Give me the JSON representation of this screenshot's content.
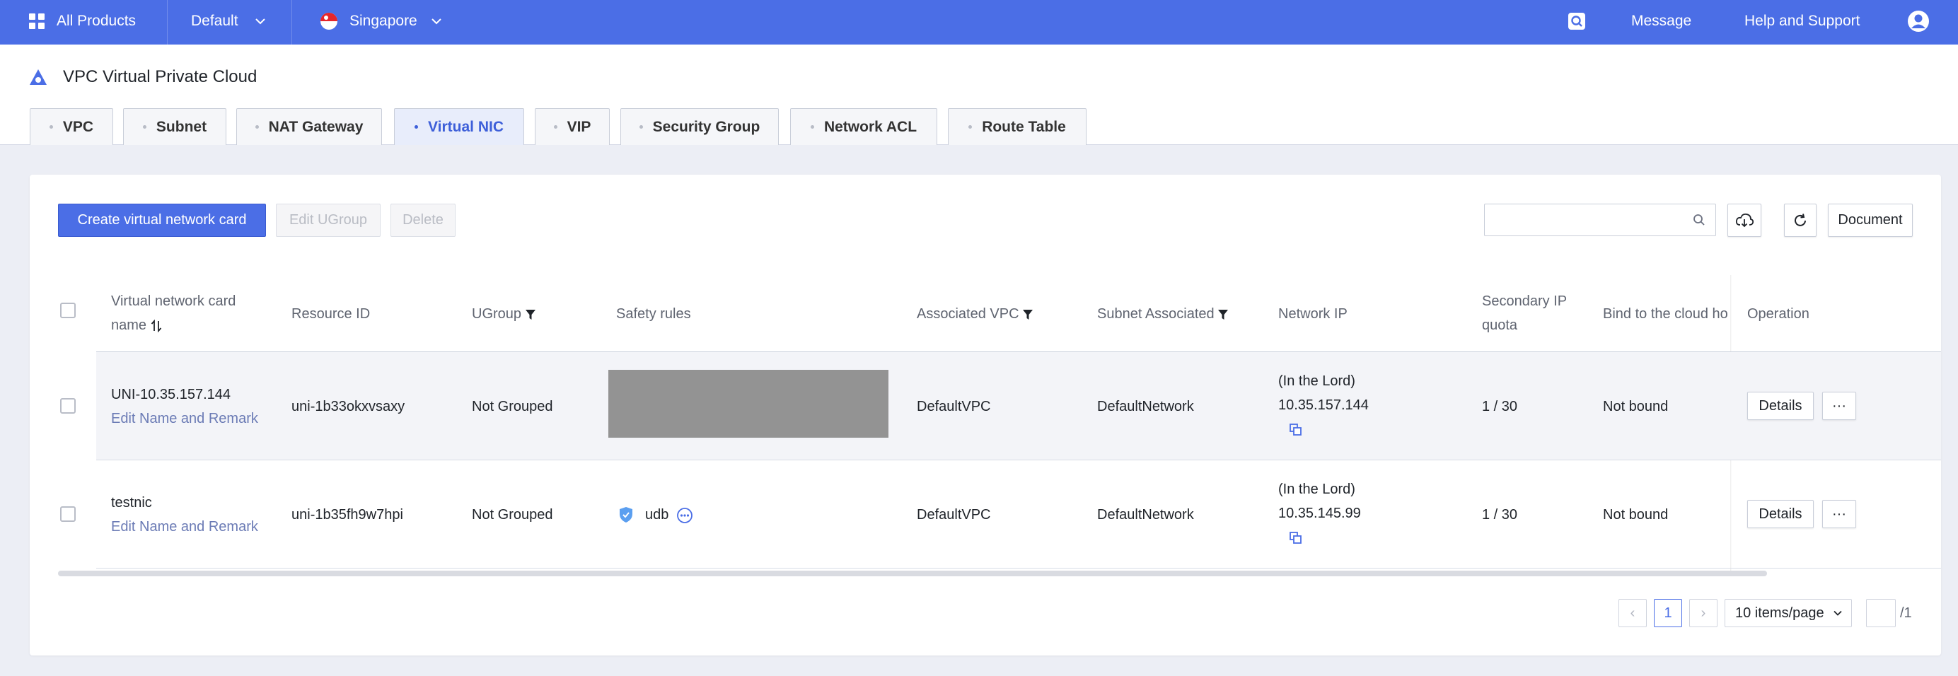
{
  "topbar": {
    "all_products": "All Products",
    "project": "Default",
    "region": "Singapore",
    "message": "Message",
    "help": "Help and Support",
    "icons": [
      "grid-icon",
      "chevron-down-icon",
      "singapore-flag-icon",
      "search-icon",
      "user-icon"
    ]
  },
  "page": {
    "title": "VPC Virtual Private Cloud"
  },
  "tabs": [
    {
      "label": "VPC"
    },
    {
      "label": "Subnet"
    },
    {
      "label": "NAT Gateway"
    },
    {
      "label": "Virtual NIC"
    },
    {
      "label": "VIP"
    },
    {
      "label": "Security Group"
    },
    {
      "label": "Network ACL"
    },
    {
      "label": "Route Table"
    }
  ],
  "active_tab": "Virtual NIC",
  "toolbar": {
    "create_label": "Create virtual network card",
    "edit_ugroup_label": "Edit UGroup",
    "delete_label": "Delete",
    "search_placeholder": "",
    "document_label": "Document"
  },
  "table": {
    "headers": {
      "name_line1": "Virtual network card",
      "name_line2": "name",
      "resource_id": "Resource ID",
      "ugroup": "UGroup",
      "safety_rules": "Safety rules",
      "vpc": "Associated VPC",
      "subnet": "Subnet Associated",
      "network_ip": "Network IP",
      "secondary_line1": "Secondary IP",
      "secondary_line2": "quota",
      "bind": "Bind to the cloud ho",
      "operation": "Operation"
    },
    "rows": [
      {
        "name": "UNI-10.35.157.144",
        "edit_link": "Edit Name and Remark",
        "resource_id": "uni-1b33okxvsaxy",
        "ugroup": "Not Grouped",
        "safety_rule": "",
        "vpc": "DefaultVPC",
        "subnet": "DefaultNetwork",
        "ip_label": "(In the Lord)",
        "ip": "10.35.157.144",
        "quota": "1 / 30",
        "bind": "Not bound",
        "details": "Details",
        "more": "···"
      },
      {
        "name": "testnic",
        "edit_link": "Edit Name and Remark",
        "resource_id": "uni-1b35fh9w7hpi",
        "ugroup": "Not Grouped",
        "safety_rule": "udb",
        "vpc": "DefaultVPC",
        "subnet": "DefaultNetwork",
        "ip_label": "(In the Lord)",
        "ip": "10.35.145.99",
        "quota": "1 / 30",
        "bind": "Not bound",
        "details": "Details",
        "more": "···"
      }
    ]
  },
  "pagination": {
    "prev": "‹",
    "current": "1",
    "next": "›",
    "page_size": "10 items/page",
    "total": "/1"
  },
  "colors": {
    "brand": "#4b6ee6",
    "active_tab_text": "#3d5fd9"
  }
}
